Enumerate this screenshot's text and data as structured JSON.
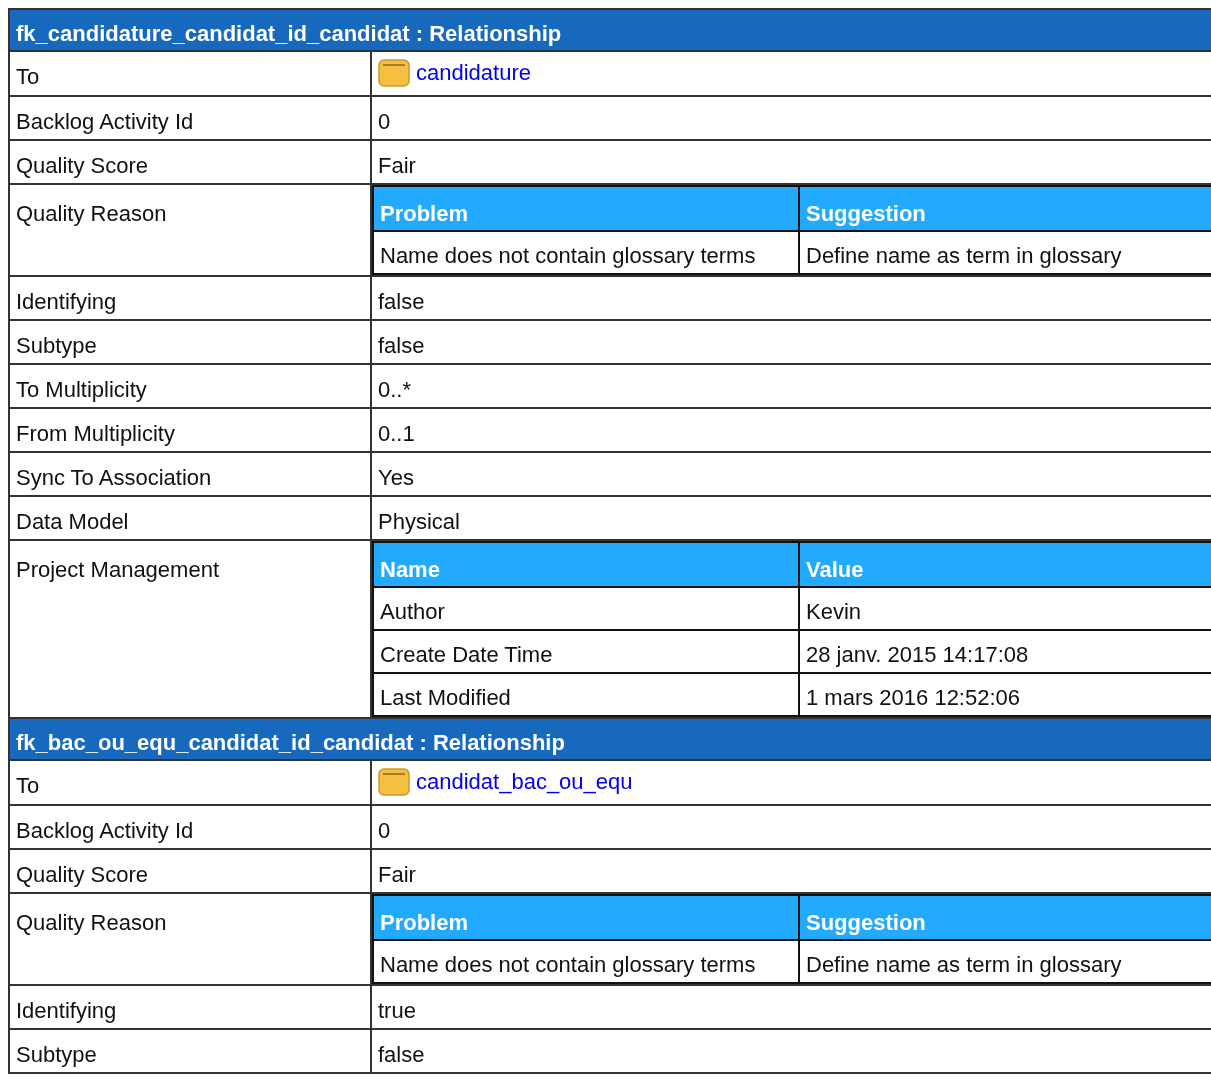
{
  "sections": [
    {
      "title": "fk_candidature_candidat_id_candidat : Relationship",
      "rows": [
        {
          "kind": "link",
          "label": "To",
          "value": "candidature"
        },
        {
          "kind": "text",
          "label": "Backlog Activity Id",
          "value": "0"
        },
        {
          "kind": "text",
          "label": "Quality Score",
          "value": "Fair"
        },
        {
          "kind": "table",
          "label": "Quality Reason",
          "columns": [
            "Problem",
            "Suggestion"
          ],
          "rows": [
            [
              "Name does not contain glossary terms",
              "Define name as term in glossary"
            ]
          ]
        },
        {
          "kind": "text",
          "label": "Identifying",
          "value": "false"
        },
        {
          "kind": "text",
          "label": "Subtype",
          "value": "false"
        },
        {
          "kind": "text",
          "label": "To Multiplicity",
          "value": "0..*"
        },
        {
          "kind": "text",
          "label": "From Multiplicity",
          "value": "0..1"
        },
        {
          "kind": "text",
          "label": "Sync To Association",
          "value": "Yes"
        },
        {
          "kind": "text",
          "label": "Data Model",
          "value": "Physical"
        },
        {
          "kind": "table",
          "label": "Project Management",
          "columns": [
            "Name",
            "Value"
          ],
          "rows": [
            [
              "Author",
              "Kevin"
            ],
            [
              "Create Date Time",
              "28 janv. 2015 14:17:08"
            ],
            [
              "Last Modified",
              "1 mars 2016 12:52:06"
            ]
          ]
        }
      ]
    },
    {
      "title": "fk_bac_ou_equ_candidat_id_candidat : Relationship",
      "rows": [
        {
          "kind": "link",
          "label": "To",
          "value": "candidat_bac_ou_equ"
        },
        {
          "kind": "text",
          "label": "Backlog Activity Id",
          "value": "0"
        },
        {
          "kind": "text",
          "label": "Quality Score",
          "value": "Fair"
        },
        {
          "kind": "table",
          "label": "Quality Reason",
          "columns": [
            "Problem",
            "Suggestion"
          ],
          "rows": [
            [
              "Name does not contain glossary terms",
              "Define name as term in glossary"
            ]
          ]
        },
        {
          "kind": "text",
          "label": "Identifying",
          "value": "true"
        },
        {
          "kind": "text",
          "label": "Subtype",
          "value": "false"
        }
      ]
    }
  ]
}
